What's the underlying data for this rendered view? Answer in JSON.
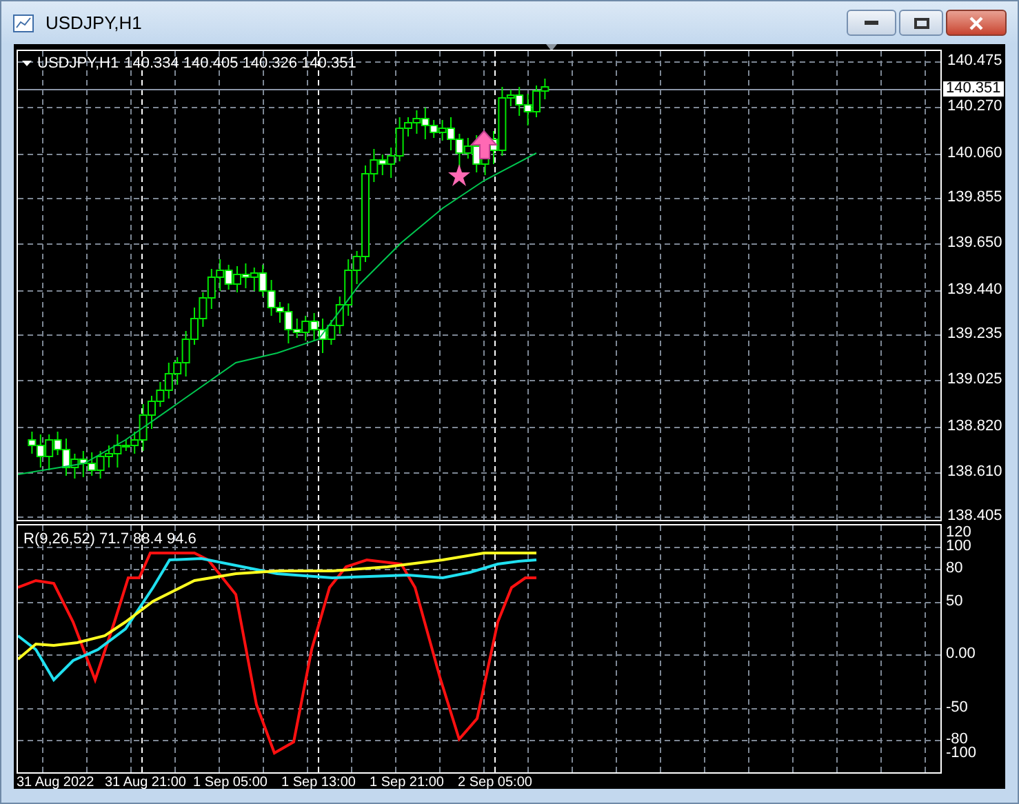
{
  "window": {
    "title": "USDJPY,H1"
  },
  "chart": {
    "header": {
      "symbol": "USDJPY,H1",
      "quote": "140.334 140.405 140.326 140.351"
    },
    "price_axis": [
      "140.475",
      "140.270",
      "140.060",
      "139.855",
      "139.650",
      "139.440",
      "139.235",
      "139.025",
      "138.820",
      "138.610",
      "138.405"
    ],
    "current_price": "140.351",
    "indicator": {
      "label": "R(9,26,52) 71.7 88.4 94.6",
      "axis": [
        "120",
        "100",
        "80",
        "50",
        "0.00",
        "-50",
        "-80",
        "-100"
      ]
    },
    "time_axis": [
      "31 Aug 2022",
      "31 Aug 21:00",
      "1 Sep 05:00",
      "1 Sep 13:00",
      "1 Sep 21:00",
      "2 Sep 05:00"
    ]
  }
}
